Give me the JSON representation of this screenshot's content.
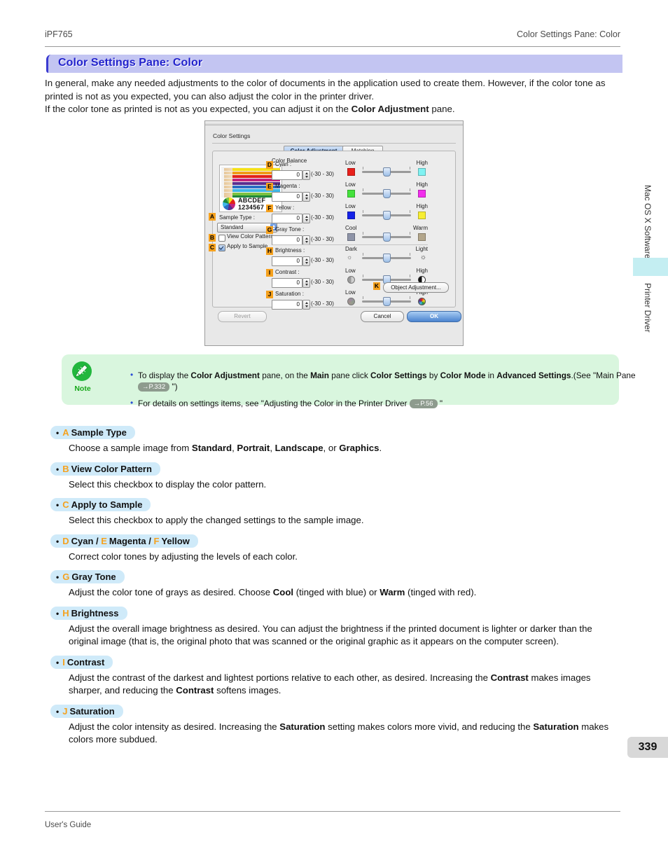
{
  "header": {
    "left": "iPF765",
    "right": "Color Settings Pane: Color"
  },
  "title": "Color Settings Pane: Color",
  "intro": {
    "line1": "In general, make any needed adjustments to the color of documents in the application used to create them. However, if the color tone as printed is not as you expected, you can also adjust the color in the printer driver.",
    "line2_pre": "If the color tone as printed is not as you expected, you can adjust it on the ",
    "line2_bold": "Color Adjustment",
    "line2_post": " pane."
  },
  "dialog": {
    "window_caption": "Color Settings",
    "tabs": [
      {
        "label": "Color Adjustment",
        "selected": true
      },
      {
        "label": "Matching",
        "selected": false
      }
    ],
    "group_label": "Color Balance",
    "sample_preview": {
      "text_line1": "ABCDEF",
      "text_line2": "1234567"
    },
    "sample_type_label": "Sample Type :",
    "sample_type_value": "Standard",
    "checkboxes": [
      {
        "label": "View Color Pattern",
        "checked": false,
        "letter": "B"
      },
      {
        "label": "Apply to Sample",
        "checked": true,
        "letter": "C"
      }
    ],
    "range_text": "(-30 - 30)",
    "controls": [
      {
        "letter": "D",
        "label": "Cyan :",
        "value": "0",
        "range": "(-30 - 30)",
        "low": "Low",
        "high": "High",
        "sw_left": "#e8201b",
        "sw_right": "#7ff2f2"
      },
      {
        "letter": "E",
        "label": "Magenta :",
        "value": "0",
        "range": "(-30 - 30)",
        "low": "Low",
        "high": "High",
        "sw_left": "#44e23c",
        "sw_right": "#f22ded"
      },
      {
        "letter": "F",
        "label": "Yellow :",
        "value": "0",
        "range": "(-30 - 30)",
        "low": "Low",
        "high": "High",
        "sw_left": "#1522e8",
        "sw_right": "#f7ee33"
      },
      {
        "letter": "G",
        "label": "Gray Tone :",
        "value": "0",
        "range": "(-30 - 30)",
        "low": "Cool",
        "high": "Warm",
        "sw_left": "#8e94a8",
        "sw_right": "#b3a68b"
      },
      {
        "letter": "H",
        "label": "Brightness :",
        "value": "0",
        "range": "(-30 - 30)",
        "low": "Dark",
        "high": "Light",
        "sw_left": "",
        "sw_right": ""
      },
      {
        "letter": "I",
        "label": "Contrast :",
        "value": "0",
        "range": "(-30 - 30)",
        "low": "Low",
        "high": "High",
        "sw_left": "",
        "sw_right": ""
      },
      {
        "letter": "J",
        "label": "Saturation :",
        "value": "0",
        "range": "(-30 - 30)",
        "low": "Low",
        "high": "High",
        "sw_left": "",
        "sw_right": ""
      }
    ],
    "object_adjustment_button": "Object Adjustment...",
    "object_adjustment_letter": "K",
    "sample_type_letter": "A",
    "revert_button": "Revert",
    "cancel_button": "Cancel",
    "ok_button": "OK"
  },
  "note": {
    "word": "Note",
    "items": [
      {
        "parts": [
          {
            "t": "To display the ",
            "b": false
          },
          {
            "t": "Color Adjustment",
            "b": true
          },
          {
            "t": " pane, on the ",
            "b": false
          },
          {
            "t": "Main",
            "b": true
          },
          {
            "t": " pane click ",
            "b": false
          },
          {
            "t": "Color Settings",
            "b": true
          },
          {
            "t": " by ",
            "b": false
          },
          {
            "t": "Color Mode",
            "b": true
          },
          {
            "t": " in ",
            "b": false
          },
          {
            "t": "Advanced Settings",
            "b": true
          },
          {
            "t": ".(See \"Main Pane ",
            "b": false
          }
        ],
        "ref": "→P.332",
        "tail": " \")"
      },
      {
        "parts": [
          {
            "t": "For details on settings items, see \"Adjusting the Color in the Printer Driver ",
            "b": false
          }
        ],
        "ref": "→P.56",
        "tail": " \""
      }
    ]
  },
  "items": [
    {
      "letter": "A",
      "heading": "Sample Type",
      "body": [
        {
          "t": "Choose a sample image from ",
          "b": false
        },
        {
          "t": "Standard",
          "b": true
        },
        {
          "t": ", ",
          "b": false
        },
        {
          "t": "Portrait",
          "b": true
        },
        {
          "t": ", ",
          "b": false
        },
        {
          "t": "Landscape",
          "b": true
        },
        {
          "t": ", or ",
          "b": false
        },
        {
          "t": "Graphics",
          "b": true
        },
        {
          "t": ".",
          "b": false
        }
      ]
    },
    {
      "letter": "B",
      "heading": "View Color Pattern",
      "body": [
        {
          "t": "Select this checkbox to display the color pattern.",
          "b": false
        }
      ]
    },
    {
      "letter": "C",
      "heading": "Apply to Sample",
      "body": [
        {
          "t": "Select this checkbox to apply the changed settings to the sample image.",
          "b": false
        }
      ]
    },
    {
      "letter": "D",
      "heading": "Cyan /",
      "letter2": "E",
      "heading2": "Magenta /",
      "letter3": "F",
      "heading3": "Yellow",
      "body": [
        {
          "t": "Correct color tones by adjusting the levels of each color.",
          "b": false
        }
      ]
    },
    {
      "letter": "G",
      "heading": "Gray Tone",
      "body": [
        {
          "t": "Adjust the color tone of grays as desired. Choose ",
          "b": false
        },
        {
          "t": "Cool",
          "b": true
        },
        {
          "t": " (tinged with blue) or ",
          "b": false
        },
        {
          "t": "Warm",
          "b": true
        },
        {
          "t": " (tinged with red).",
          "b": false
        }
      ]
    },
    {
      "letter": "H",
      "heading": "Brightness",
      "body": [
        {
          "t": "Adjust the overall image brightness as desired. You can adjust the brightness if the printed document is lighter or darker than the original image (that is, the original photo that was scanned or the original graphic as it appears on the computer screen).",
          "b": false
        }
      ]
    },
    {
      "letter": "I",
      "heading": "Contrast",
      "body": [
        {
          "t": "Adjust the contrast of the darkest and lightest portions relative to each other, as desired. Increasing the ",
          "b": false
        },
        {
          "t": "Contrast",
          "b": true
        },
        {
          "t": " makes images sharper, and reducing the ",
          "b": false
        },
        {
          "t": "Contrast",
          "b": true
        },
        {
          "t": " softens images.",
          "b": false
        }
      ]
    },
    {
      "letter": "J",
      "heading": "Saturation",
      "body": [
        {
          "t": "Adjust the color intensity as desired. Increasing the ",
          "b": false
        },
        {
          "t": "Saturation",
          "b": true
        },
        {
          "t": " setting makes colors more vivid, and reducing the ",
          "b": false
        },
        {
          "t": "Saturation",
          "b": true
        },
        {
          "t": " makes colors more subdued.",
          "b": false
        }
      ]
    }
  ],
  "side_tabs": [
    {
      "label": "Mac OS X Software"
    },
    {
      "label": "Printer Driver"
    }
  ],
  "page_number": "339",
  "footer": "User's Guide",
  "colors": {
    "title_text": "#2222cc",
    "title_bg": "#c3c5f2",
    "letter_badge": "#f5a11e",
    "item_head_bg": "#cfeaf9",
    "note_bg": "#d9f6de",
    "note_green": "#17a81a",
    "side_highlight": "#c4eef2"
  }
}
